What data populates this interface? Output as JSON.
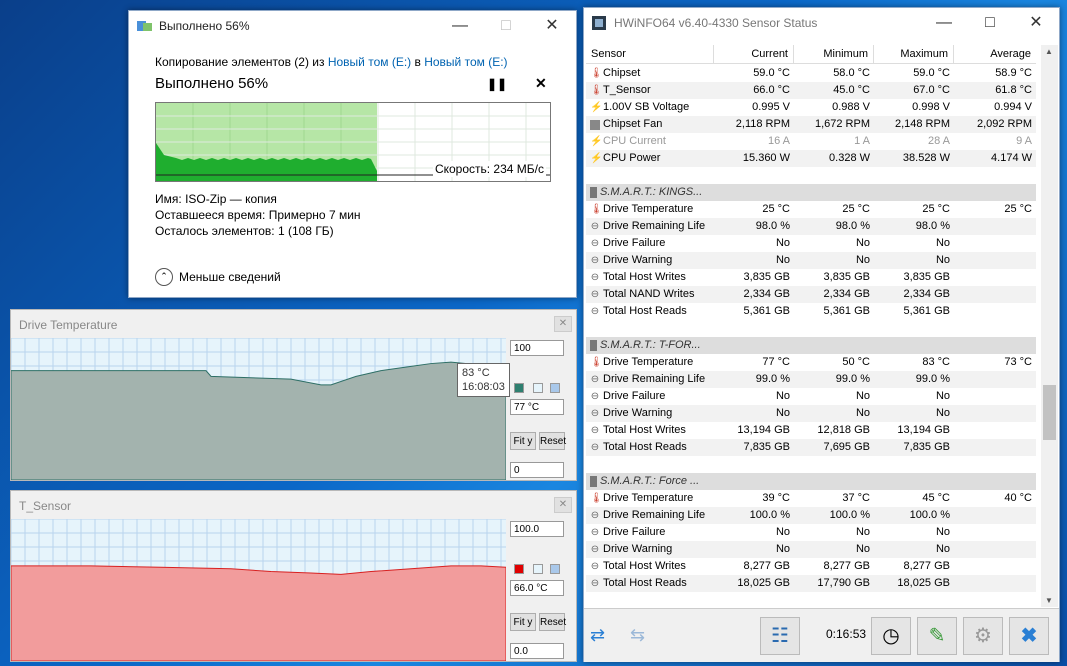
{
  "copy_dialog": {
    "title": "Выполнено 56%",
    "line_prefix": "Копирование элементов (2) из ",
    "source": "Новый том (E:)",
    "line_mid": " в ",
    "dest": "Новый том (E:)",
    "progress_label": "Выполнено 56%",
    "progress_fraction": 0.56,
    "speed": "Скорость: 234 МБ/с",
    "name_label": "Имя:",
    "name_value": "ISO-Zip — копия",
    "time_label": "Оставшееся время:",
    "time_value": "Примерно 7 мин",
    "items_label": "Осталось элементов:",
    "items_value": "1 (108 ГБ)",
    "less_details": "Меньше сведений"
  },
  "drive_temp_graph": {
    "title": "Drive Temperature",
    "max": "100",
    "current": "77 °C",
    "min": "0",
    "tooltip_value": "83 °C",
    "tooltip_time": "16:08:03",
    "fit_label": "Fit y",
    "reset_label": "Reset",
    "swatch_color": "#2e7f6f"
  },
  "tsensor_graph": {
    "title": "T_Sensor",
    "max": "100.0",
    "current": "66.0 °C",
    "min": "0.0",
    "fit_label": "Fit y",
    "reset_label": "Reset",
    "swatch_color": "#e00000"
  },
  "hwinfo": {
    "title": "HWiNFO64 v6.40-4330 Sensor Status",
    "columns": [
      "Sensor",
      "Current",
      "Minimum",
      "Maximum",
      "Average"
    ],
    "rows": [
      {
        "icon": "therm",
        "name": "Chipset",
        "cur": "59.0 °C",
        "min": "58.0 °C",
        "max": "59.0 °C",
        "avg": "58.9 °C"
      },
      {
        "icon": "therm",
        "name": "T_Sensor",
        "cur": "66.0 °C",
        "min": "45.0 °C",
        "max": "67.0 °C",
        "avg": "61.8 °C"
      },
      {
        "icon": "bolt",
        "name": "1.00V SB Voltage",
        "cur": "0.995 V",
        "min": "0.988 V",
        "max": "0.998 V",
        "avg": "0.994 V"
      },
      {
        "icon": "chip",
        "name": "Chipset Fan",
        "cur": "2,118 RPM",
        "min": "1,672 RPM",
        "max": "2,148 RPM",
        "avg": "2,092 RPM"
      },
      {
        "icon": "bolt",
        "name": "CPU Current",
        "cur": "16 A",
        "min": "1 A",
        "max": "28 A",
        "avg": "9 A",
        "dim": true
      },
      {
        "icon": "bolt",
        "name": "CPU Power",
        "cur": "15.360 W",
        "min": "0.328 W",
        "max": "38.528 W",
        "avg": "4.174 W"
      },
      {
        "gap": true
      },
      {
        "group": true,
        "icon": "disk",
        "name": "S.M.A.R.T.: KINGS..."
      },
      {
        "icon": "therm",
        "name": "Drive Temperature",
        "cur": "25 °C",
        "min": "25 °C",
        "max": "25 °C",
        "avg": "25 °C"
      },
      {
        "icon": "dot",
        "name": "Drive Remaining Life",
        "cur": "98.0 %",
        "min": "98.0 %",
        "max": "98.0 %",
        "avg": ""
      },
      {
        "icon": "dot",
        "name": "Drive Failure",
        "cur": "No",
        "min": "No",
        "max": "No",
        "avg": ""
      },
      {
        "icon": "dot",
        "name": "Drive Warning",
        "cur": "No",
        "min": "No",
        "max": "No",
        "avg": ""
      },
      {
        "icon": "dot",
        "name": "Total Host Writes",
        "cur": "3,835 GB",
        "min": "3,835 GB",
        "max": "3,835 GB",
        "avg": ""
      },
      {
        "icon": "dot",
        "name": "Total NAND Writes",
        "cur": "2,334 GB",
        "min": "2,334 GB",
        "max": "2,334 GB",
        "avg": ""
      },
      {
        "icon": "dot",
        "name": "Total Host Reads",
        "cur": "5,361 GB",
        "min": "5,361 GB",
        "max": "5,361 GB",
        "avg": ""
      },
      {
        "gap": true
      },
      {
        "group": true,
        "icon": "disk",
        "name": "S.M.A.R.T.: T-FOR..."
      },
      {
        "icon": "therm",
        "name": "Drive Temperature",
        "cur": "77 °C",
        "min": "50 °C",
        "max": "83 °C",
        "avg": "73 °C"
      },
      {
        "icon": "dot",
        "name": "Drive Remaining Life",
        "cur": "99.0 %",
        "min": "99.0 %",
        "max": "99.0 %",
        "avg": ""
      },
      {
        "icon": "dot",
        "name": "Drive Failure",
        "cur": "No",
        "min": "No",
        "max": "No",
        "avg": ""
      },
      {
        "icon": "dot",
        "name": "Drive Warning",
        "cur": "No",
        "min": "No",
        "max": "No",
        "avg": ""
      },
      {
        "icon": "dot",
        "name": "Total Host Writes",
        "cur": "13,194 GB",
        "min": "12,818 GB",
        "max": "13,194 GB",
        "avg": ""
      },
      {
        "icon": "dot",
        "name": "Total Host Reads",
        "cur": "7,835 GB",
        "min": "7,695 GB",
        "max": "7,835 GB",
        "avg": ""
      },
      {
        "gap": true
      },
      {
        "group": true,
        "icon": "disk",
        "name": "S.M.A.R.T.: Force ..."
      },
      {
        "icon": "therm",
        "name": "Drive Temperature",
        "cur": "39 °C",
        "min": "37 °C",
        "max": "45 °C",
        "avg": "40 °C"
      },
      {
        "icon": "dot",
        "name": "Drive Remaining Life",
        "cur": "100.0 %",
        "min": "100.0 %",
        "max": "100.0 %",
        "avg": ""
      },
      {
        "icon": "dot",
        "name": "Drive Failure",
        "cur": "No",
        "min": "No",
        "max": "No",
        "avg": ""
      },
      {
        "icon": "dot",
        "name": "Drive Warning",
        "cur": "No",
        "min": "No",
        "max": "No",
        "avg": ""
      },
      {
        "icon": "dot",
        "name": "Total Host Writes",
        "cur": "8,277 GB",
        "min": "8,277 GB",
        "max": "8,277 GB",
        "avg": ""
      },
      {
        "icon": "dot",
        "name": "Total Host Reads",
        "cur": "18,025 GB",
        "min": "17,790 GB",
        "max": "18,025 GB",
        "avg": ""
      }
    ],
    "elapsed": "0:16:53"
  }
}
